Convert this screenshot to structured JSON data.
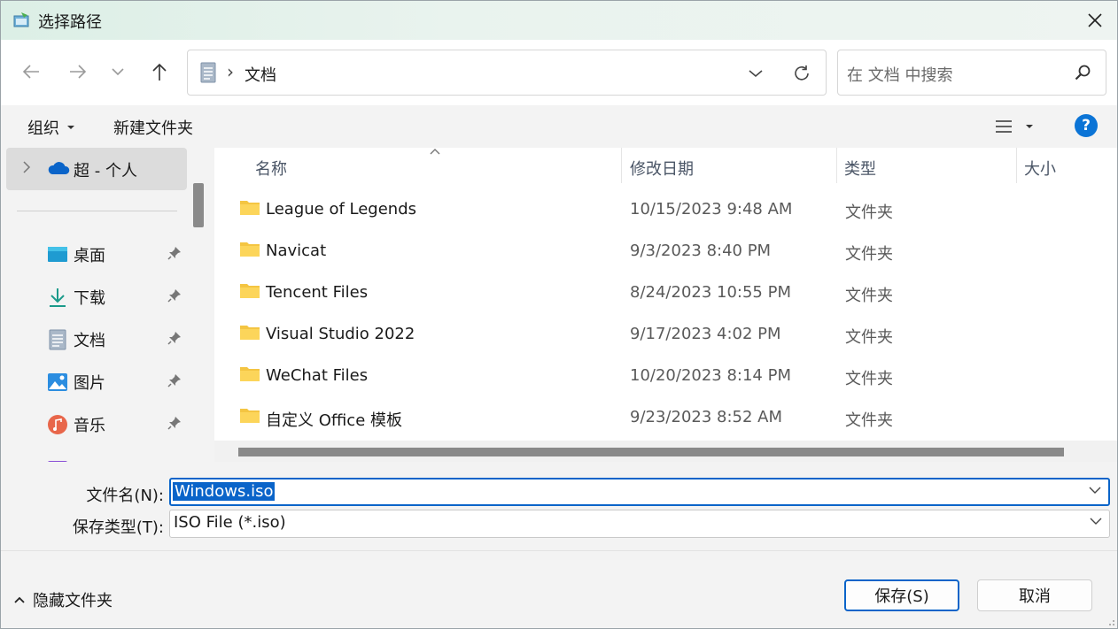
{
  "window": {
    "title": "选择路径"
  },
  "nav": {
    "breadcrumb_current": "文档",
    "search_placeholder": "在 文档 中搜索"
  },
  "toolbar": {
    "organize_label": "组织",
    "new_folder_label": "新建文件夹"
  },
  "sidebar": {
    "onedrive_label": "超 - 个人",
    "items": [
      {
        "label": "桌面",
        "icon": "desktop-icon",
        "pinned": true
      },
      {
        "label": "下载",
        "icon": "download-icon",
        "pinned": true
      },
      {
        "label": "文档",
        "icon": "documents-icon",
        "pinned": true
      },
      {
        "label": "图片",
        "icon": "pictures-icon",
        "pinned": true
      },
      {
        "label": "音乐",
        "icon": "music-icon",
        "pinned": true
      }
    ]
  },
  "filelist": {
    "columns": [
      "名称",
      "修改日期",
      "类型",
      "大小"
    ],
    "rows": [
      {
        "name": "League of Legends",
        "date": "10/15/2023 9:48 AM",
        "type": "文件夹"
      },
      {
        "name": "Navicat",
        "date": "9/3/2023 8:40 PM",
        "type": "文件夹"
      },
      {
        "name": "Tencent Files",
        "date": "8/24/2023 10:55 PM",
        "type": "文件夹"
      },
      {
        "name": "Visual Studio 2022",
        "date": "9/17/2023 4:02 PM",
        "type": "文件夹"
      },
      {
        "name": "WeChat Files",
        "date": "10/20/2023 8:14 PM",
        "type": "文件夹"
      },
      {
        "name": "自定义 Office 模板",
        "date": "9/23/2023 8:52 AM",
        "type": "文件夹"
      }
    ]
  },
  "fields": {
    "filename_label": "文件名(N):",
    "filename_value": "Windows.iso",
    "filetype_label": "保存类型(T):",
    "filetype_value": "ISO File (*.iso)"
  },
  "footer": {
    "hide_folders_label": "隐藏文件夹",
    "save_label": "保存(S)",
    "cancel_label": "取消"
  },
  "colors": {
    "accent": "#0a64c9",
    "folder": "#f4c542",
    "help": "#0b74d6"
  }
}
